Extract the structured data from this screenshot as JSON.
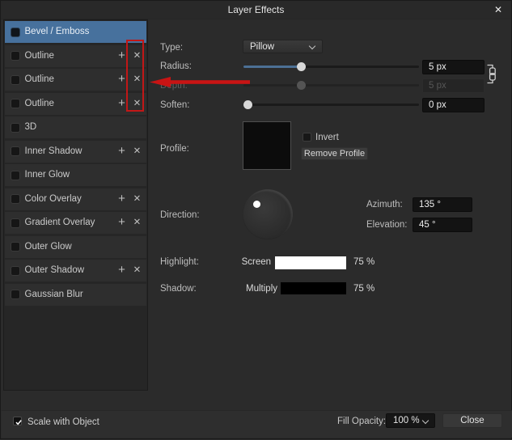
{
  "title_bar": {
    "title": "Layer Effects",
    "close_icon": "✕"
  },
  "sidebar": {
    "items": [
      {
        "label": "Bevel / Emboss",
        "selected": true,
        "checked": false,
        "has_actions": false
      },
      {
        "label": "Outline",
        "selected": false,
        "checked": false,
        "has_actions": true
      },
      {
        "label": "Outline",
        "selected": false,
        "checked": false,
        "has_actions": true
      },
      {
        "label": "Outline",
        "selected": false,
        "checked": false,
        "has_actions": true
      },
      {
        "label": "3D",
        "selected": false,
        "checked": false,
        "has_actions": false
      },
      {
        "label": "Inner Shadow",
        "selected": false,
        "checked": false,
        "has_actions": true
      },
      {
        "label": "Inner Glow",
        "selected": false,
        "checked": false,
        "has_actions": false
      },
      {
        "label": "Color Overlay",
        "selected": false,
        "checked": false,
        "has_actions": true
      },
      {
        "label": "Gradient Overlay",
        "selected": false,
        "checked": false,
        "has_actions": true
      },
      {
        "label": "Outer Glow",
        "selected": false,
        "checked": false,
        "has_actions": false
      },
      {
        "label": "Outer Shadow",
        "selected": false,
        "checked": false,
        "has_actions": true
      },
      {
        "label": "Gaussian Blur",
        "selected": false,
        "checked": false,
        "has_actions": false
      }
    ],
    "add_icon": "+",
    "remove_icon": "✕",
    "selected_color": "#47719d"
  },
  "panel": {
    "type": {
      "label": "Type:",
      "value": "Pillow"
    },
    "radius": {
      "label": "Radius:",
      "value": "5 px",
      "fraction": 0.33
    },
    "depth": {
      "label": "Depth:",
      "value": "5 px",
      "fraction": 0.33,
      "disabled": true
    },
    "soften": {
      "label": "Soften:",
      "value": "0 px",
      "fraction": 0.0
    },
    "link_radius_depth_icon": "link-chain",
    "profile": {
      "label": "Profile:",
      "invert_label": "Invert",
      "invert_checked": false,
      "remove_button_label": "Remove Profile"
    },
    "direction": {
      "label": "Direction:",
      "azimuth_deg": 135,
      "elevation_deg": 45
    },
    "azimuth": {
      "label": "Azimuth:",
      "value": "135 °"
    },
    "elevation": {
      "label": "Elevation:",
      "value": "45 °"
    },
    "highlight": {
      "label": "Highlight:",
      "blend_mode": "Screen",
      "color": "#ffffff",
      "opacity": "75 %"
    },
    "shadow": {
      "label": "Shadow:",
      "blend_mode": "Multiply",
      "color": "#000000",
      "opacity": "75 %"
    }
  },
  "footer": {
    "scale_label": "Scale with Object",
    "scale_checked": true,
    "fill_opacity_label": "Fill Opacity:",
    "fill_opacity_value": "100 %",
    "close_label": "Close"
  },
  "annotation": {
    "shape": "rectangle-and-arrow",
    "color": "#c21717",
    "highlights": "delete buttons of the three Outline effects"
  }
}
